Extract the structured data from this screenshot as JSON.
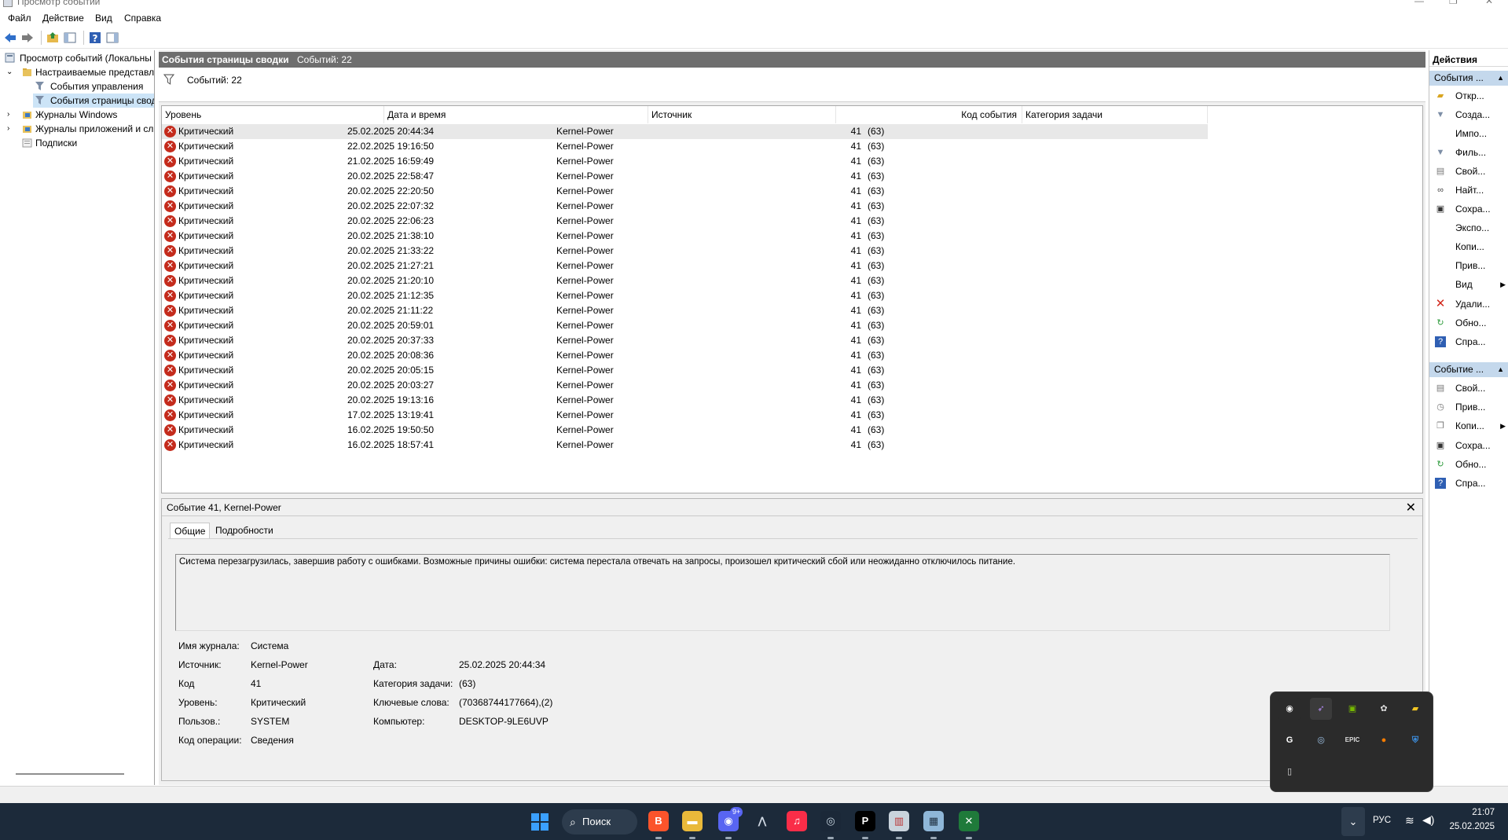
{
  "window": {
    "title": "Просмотр событий"
  },
  "menu": [
    "Файл",
    "Действие",
    "Вид",
    "Справка"
  ],
  "tree": [
    {
      "label": "Просмотр событий (Локальны"
    },
    {
      "label": "Настраиваемые представле"
    },
    {
      "label": "События управления"
    },
    {
      "label": "События страницы свод"
    },
    {
      "label": "Журналы Windows"
    },
    {
      "label": "Журналы приложений и сл"
    },
    {
      "label": "Подписки"
    }
  ],
  "center": {
    "header_title": "События страницы сводки",
    "header_count": "Событий: 22",
    "filter_count": "Событий: 22"
  },
  "table": {
    "columns": [
      "Уровень",
      "Дата и время",
      "Источник",
      "Код события",
      "Категория задачи"
    ],
    "rows": [
      [
        "Критический",
        "25.02.2025 20:44:34",
        "Kernel-Power",
        "41",
        "(63)"
      ],
      [
        "Критический",
        "22.02.2025 19:16:50",
        "Kernel-Power",
        "41",
        "(63)"
      ],
      [
        "Критический",
        "21.02.2025 16:59:49",
        "Kernel-Power",
        "41",
        "(63)"
      ],
      [
        "Критический",
        "20.02.2025 22:58:47",
        "Kernel-Power",
        "41",
        "(63)"
      ],
      [
        "Критический",
        "20.02.2025 22:20:50",
        "Kernel-Power",
        "41",
        "(63)"
      ],
      [
        "Критический",
        "20.02.2025 22:07:32",
        "Kernel-Power",
        "41",
        "(63)"
      ],
      [
        "Критический",
        "20.02.2025 22:06:23",
        "Kernel-Power",
        "41",
        "(63)"
      ],
      [
        "Критический",
        "20.02.2025 21:38:10",
        "Kernel-Power",
        "41",
        "(63)"
      ],
      [
        "Критический",
        "20.02.2025 21:33:22",
        "Kernel-Power",
        "41",
        "(63)"
      ],
      [
        "Критический",
        "20.02.2025 21:27:21",
        "Kernel-Power",
        "41",
        "(63)"
      ],
      [
        "Критический",
        "20.02.2025 21:20:10",
        "Kernel-Power",
        "41",
        "(63)"
      ],
      [
        "Критический",
        "20.02.2025 21:12:35",
        "Kernel-Power",
        "41",
        "(63)"
      ],
      [
        "Критический",
        "20.02.2025 21:11:22",
        "Kernel-Power",
        "41",
        "(63)"
      ],
      [
        "Критический",
        "20.02.2025 20:59:01",
        "Kernel-Power",
        "41",
        "(63)"
      ],
      [
        "Критический",
        "20.02.2025 20:37:33",
        "Kernel-Power",
        "41",
        "(63)"
      ],
      [
        "Критический",
        "20.02.2025 20:08:36",
        "Kernel-Power",
        "41",
        "(63)"
      ],
      [
        "Критический",
        "20.02.2025 20:05:15",
        "Kernel-Power",
        "41",
        "(63)"
      ],
      [
        "Критический",
        "20.02.2025 20:03:27",
        "Kernel-Power",
        "41",
        "(63)"
      ],
      [
        "Критический",
        "20.02.2025 19:13:16",
        "Kernel-Power",
        "41",
        "(63)"
      ],
      [
        "Критический",
        "17.02.2025 13:19:41",
        "Kernel-Power",
        "41",
        "(63)"
      ],
      [
        "Критический",
        "16.02.2025 19:50:50",
        "Kernel-Power",
        "41",
        "(63)"
      ],
      [
        "Критический",
        "16.02.2025 18:57:41",
        "Kernel-Power",
        "41",
        "(63)"
      ]
    ]
  },
  "details": {
    "title": "Событие 41, Kernel-Power",
    "tabs": [
      "Общие",
      "Подробности"
    ],
    "description": "Система перезагрузилась, завершив работу с ошибками. Возможные причины ошибки: система перестала отвечать на запросы, произошел критический сбой или неожиданно отключилось питание.",
    "left_fields": [
      {
        "label": "Имя журнала:",
        "value": "Система"
      },
      {
        "label": "Источник:",
        "value": "Kernel-Power"
      },
      {
        "label": "Код",
        "value": "41"
      },
      {
        "label": "Уровень:",
        "value": "Критический"
      },
      {
        "label": "Пользов.:",
        "value": "SYSTEM"
      },
      {
        "label": "Код операции:",
        "value": "Сведения"
      }
    ],
    "right_fields": [
      {
        "label": "Дата:",
        "value": "25.02.2025 20:44:34"
      },
      {
        "label": "Категория задачи:",
        "value": "(63)"
      },
      {
        "label": "Ключевые слова:",
        "value": "(70368744177664),(2)"
      },
      {
        "label": "Компьютер:",
        "value": "DESKTOP-9LE6UVP"
      }
    ]
  },
  "actions": {
    "title": "Действия",
    "section1": "События ...",
    "section1_items": [
      "Откр...",
      "Созда...",
      "Импо...",
      "Филь...",
      "Свой...",
      "Найт...",
      "Сохра...",
      "Экспо...",
      "Копи...",
      "Прив...",
      "Вид",
      "Удали...",
      "Обно...",
      "Спра..."
    ],
    "section2": "Событие ...",
    "section2_items": [
      "Свой...",
      "Прив...",
      "Копи...",
      "Сохра...",
      "Обно...",
      "Спра..."
    ]
  },
  "taskbar": {
    "search": "Поиск",
    "discord_badge": "9+",
    "lang": "РУС",
    "time": "21:07",
    "date": "25.02.2025"
  },
  "tray_flyout": {
    "icons": [
      "discord-tray-icon",
      "feather-tray-icon",
      "nvidia-tray-icon",
      "chatgpt-tray-icon",
      "app-tray-icon",
      "logitech-g-tray-icon",
      "steam-tray-icon",
      "epic-games-tray-icon",
      "orange-app-tray-icon",
      "defender-warning-tray-icon",
      "usb-device-tray-icon"
    ]
  },
  "colors": {
    "critical": "#c42b1c",
    "header_gray": "#6e6e6e",
    "action_section": "#c4d8ec",
    "taskbar": "#1c2a3a"
  }
}
